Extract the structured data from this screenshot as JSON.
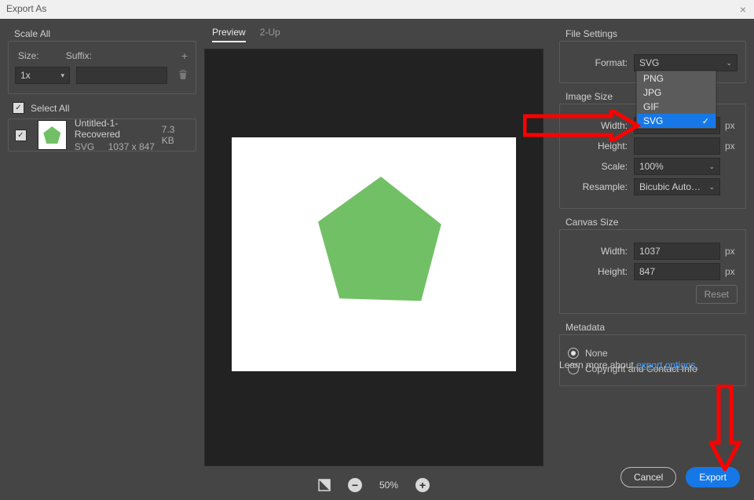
{
  "window": {
    "title": "Export As"
  },
  "scale": {
    "group_title": "Scale All",
    "size_label": "Size:",
    "suffix_label": "Suffix:",
    "size_value": "1x",
    "suffix_value": ""
  },
  "assets": {
    "select_all_label": "Select All",
    "item": {
      "name": "Untitled-1-Recovered",
      "format": "SVG",
      "dimensions": "1037 x 847",
      "filesize": "7.3 KB"
    }
  },
  "preview": {
    "tab_preview": "Preview",
    "tab_2up": "2-Up",
    "zoom": "50%"
  },
  "file_settings": {
    "group_title": "File Settings",
    "format_label": "Format:",
    "format_value": "SVG",
    "options": [
      "PNG",
      "JPG",
      "GIF",
      "SVG"
    ],
    "selected_index": 3
  },
  "image_size": {
    "group_title": "Image Size",
    "width_label": "Width:",
    "height_label": "Height:",
    "scale_label": "Scale:",
    "scale_value": "100%",
    "resample_label": "Resample:",
    "resample_value": "Bicubic Auto…",
    "px": "px"
  },
  "canvas_size": {
    "group_title": "Canvas Size",
    "width_label": "Width:",
    "width_value": "1037",
    "height_label": "Height:",
    "height_value": "847",
    "px": "px",
    "reset": "Reset"
  },
  "metadata": {
    "group_title": "Metadata",
    "none": "None",
    "copyright": "Copyright and Contact Info"
  },
  "learn": {
    "text": "Learn more about ",
    "link": "export options."
  },
  "footer": {
    "cancel": "Cancel",
    "export": "Export"
  }
}
